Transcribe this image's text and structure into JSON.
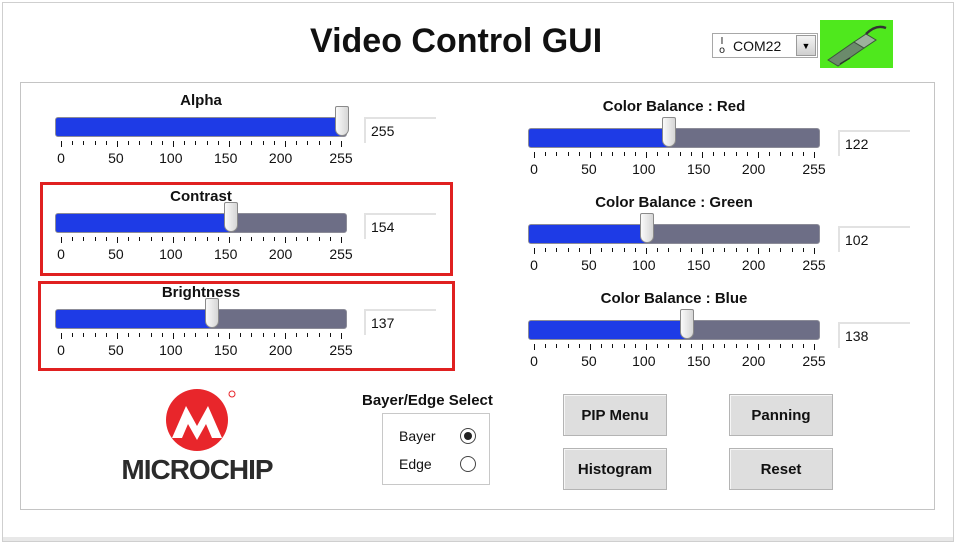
{
  "title": "Video Control GUI",
  "com_port": {
    "io_icon": "io-port-icon",
    "value": "COM22"
  },
  "status_icon": "usb-plug-icon",
  "status_color": "#4fe81d",
  "scale_labels": [
    "0",
    "50",
    "100",
    "150",
    "200",
    "255"
  ],
  "sliders": {
    "alpha": {
      "label": "Alpha",
      "value": "255",
      "max": 255
    },
    "contrast": {
      "label": "Contrast",
      "value": "154",
      "max": 255
    },
    "brightness": {
      "label": "Brightness",
      "value": "137",
      "max": 255
    },
    "red": {
      "label": "Color Balance : Red",
      "value": "122",
      "max": 255
    },
    "green": {
      "label": "Color Balance : Green",
      "value": "102",
      "max": 255
    },
    "blue": {
      "label": "Color Balance : Blue",
      "value": "138",
      "max": 255
    }
  },
  "logo": {
    "text": "MICROCHIP",
    "color": "#e8262b"
  },
  "bayer_edge": {
    "title": "Bayer/Edge Select",
    "options": [
      {
        "label": "Bayer",
        "selected": true
      },
      {
        "label": "Edge",
        "selected": false
      }
    ]
  },
  "buttons": {
    "pip_menu": "PIP Menu",
    "panning": "Panning",
    "histogram": "Histogram",
    "reset": "Reset"
  },
  "colors": {
    "fill": "#1e3be6",
    "track": "#6d6e86",
    "highlight": "#e02020"
  }
}
